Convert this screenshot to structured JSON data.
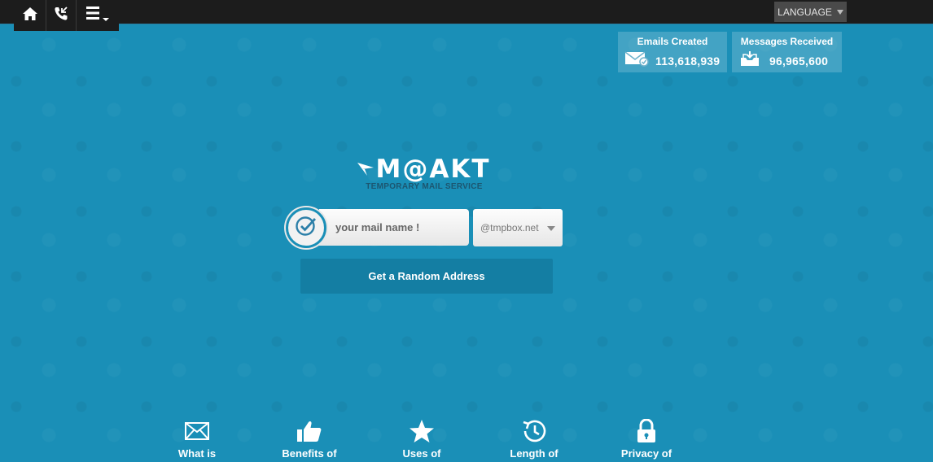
{
  "nav": {
    "items": [
      {
        "name": "home-icon"
      },
      {
        "name": "phone-icon"
      },
      {
        "name": "menu-icon"
      }
    ]
  },
  "language": {
    "label": "LANGUAGE"
  },
  "stats": {
    "emails_created": {
      "label": "Emails Created",
      "value": "113,618,939",
      "icon": "mail-check-icon"
    },
    "messages_received": {
      "label": "Messages Received",
      "value": "96,965,600",
      "icon": "inbox-icon"
    }
  },
  "logo": {
    "brand": "M@AKT",
    "tagline": "TEMPORARY MAIL SERVICE"
  },
  "form": {
    "mailname_placeholder": "your mail name !",
    "mailname_value": "",
    "domain_selected": "@tmpbox.net",
    "random_button": "Get a Random Address"
  },
  "features": [
    {
      "label": "What is",
      "icon": "envelope-icon"
    },
    {
      "label": "Benefits of",
      "icon": "thumbs-up-icon"
    },
    {
      "label": "Uses of",
      "icon": "star-icon"
    },
    {
      "label": "Length of",
      "icon": "history-icon"
    },
    {
      "label": "Privacy of",
      "icon": "lock-icon"
    }
  ],
  "colors": {
    "background": "#1a8fb7",
    "topbar": "#1c1c1c",
    "button": "#147ea3",
    "tagline": "#1c5670"
  }
}
